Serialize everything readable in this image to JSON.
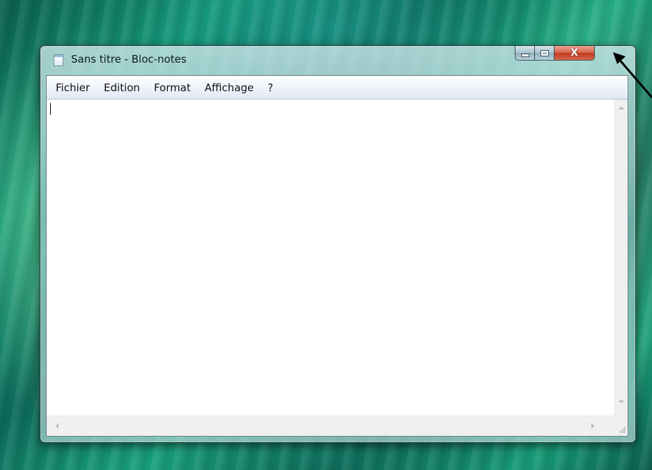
{
  "window": {
    "title": "Sans titre - Bloc-notes",
    "icon": "notepad-icon"
  },
  "caption_buttons": {
    "minimize_icon": "minimize-icon",
    "maximize_icon": "maximize-icon",
    "close_glyph": "X"
  },
  "menubar": {
    "items": [
      {
        "label": "Fichier"
      },
      {
        "label": "Edition"
      },
      {
        "label": "Format"
      },
      {
        "label": "Affichage"
      },
      {
        "label": "?"
      }
    ]
  },
  "editor": {
    "value": ""
  },
  "colors": {
    "close_button": "#c0381c",
    "pointer_arrow": "#000000"
  }
}
